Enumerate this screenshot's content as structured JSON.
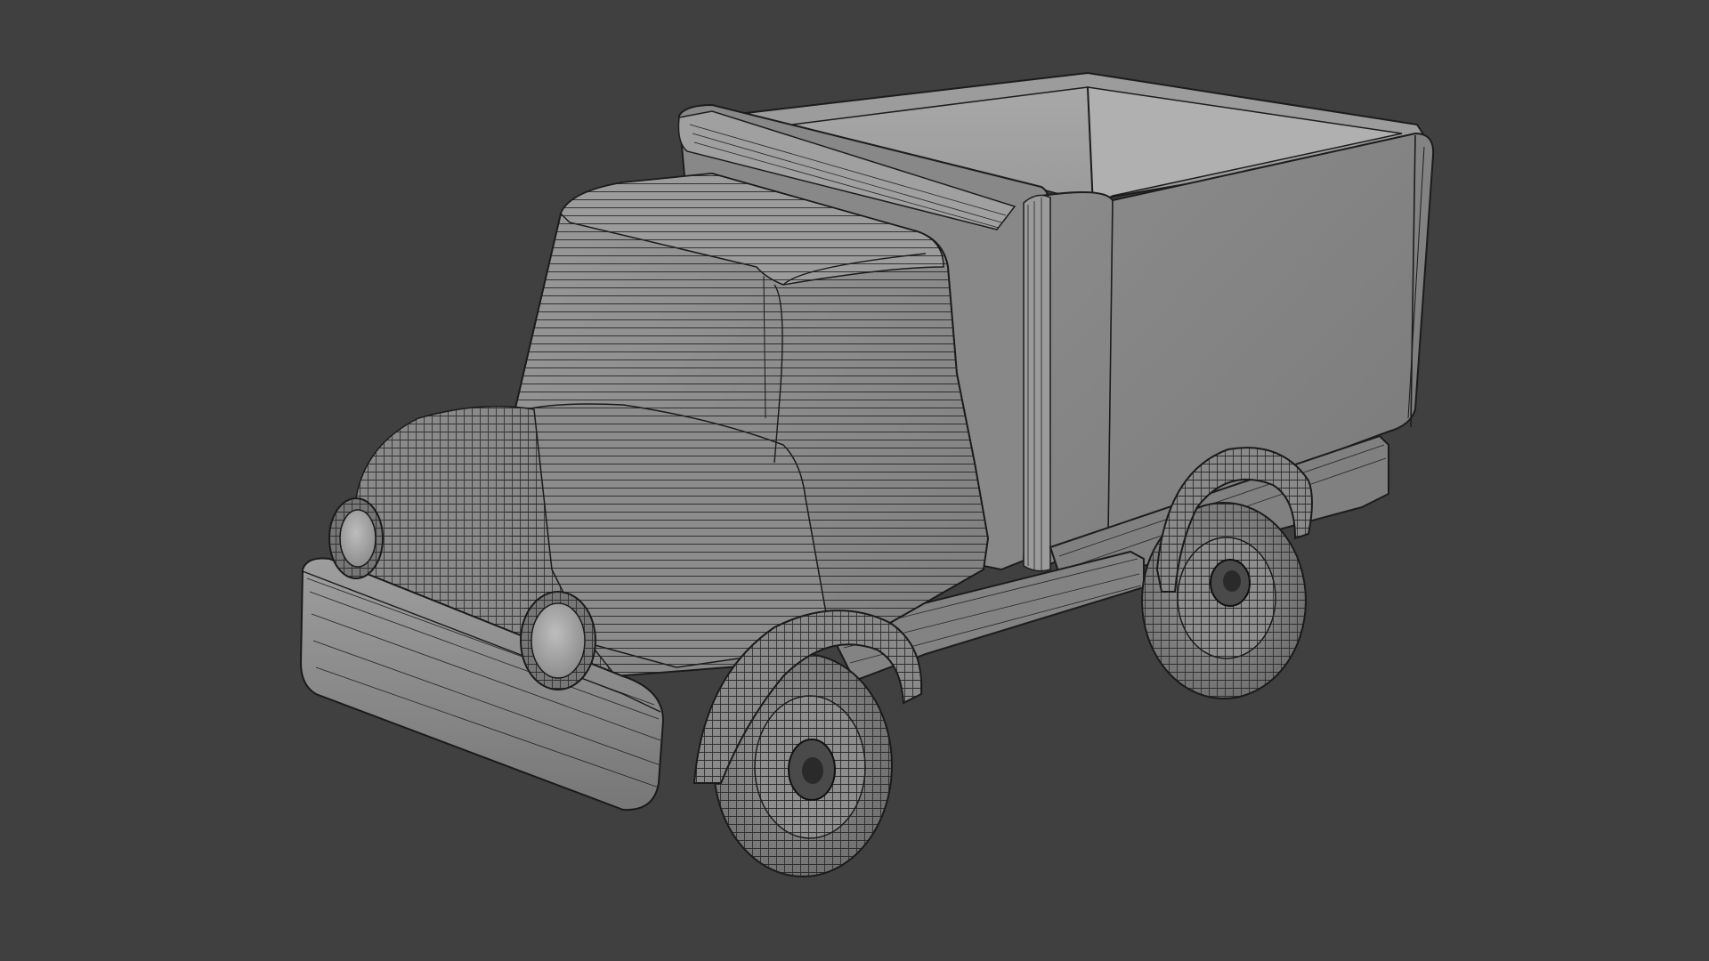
{
  "viewport": {
    "background_color": "#404040",
    "shading": "solid-with-wireframe",
    "object_color": "#8f8f8f",
    "wire_color": "#1b1b1b"
  },
  "model": {
    "subject": "toy-truck",
    "parts": [
      "cab",
      "cargo-box",
      "chassis-rail",
      "front-bumper",
      "headlight-left",
      "headlight-right",
      "front-wheel",
      "rear-wheel",
      "front-fender",
      "rear-fender"
    ]
  }
}
